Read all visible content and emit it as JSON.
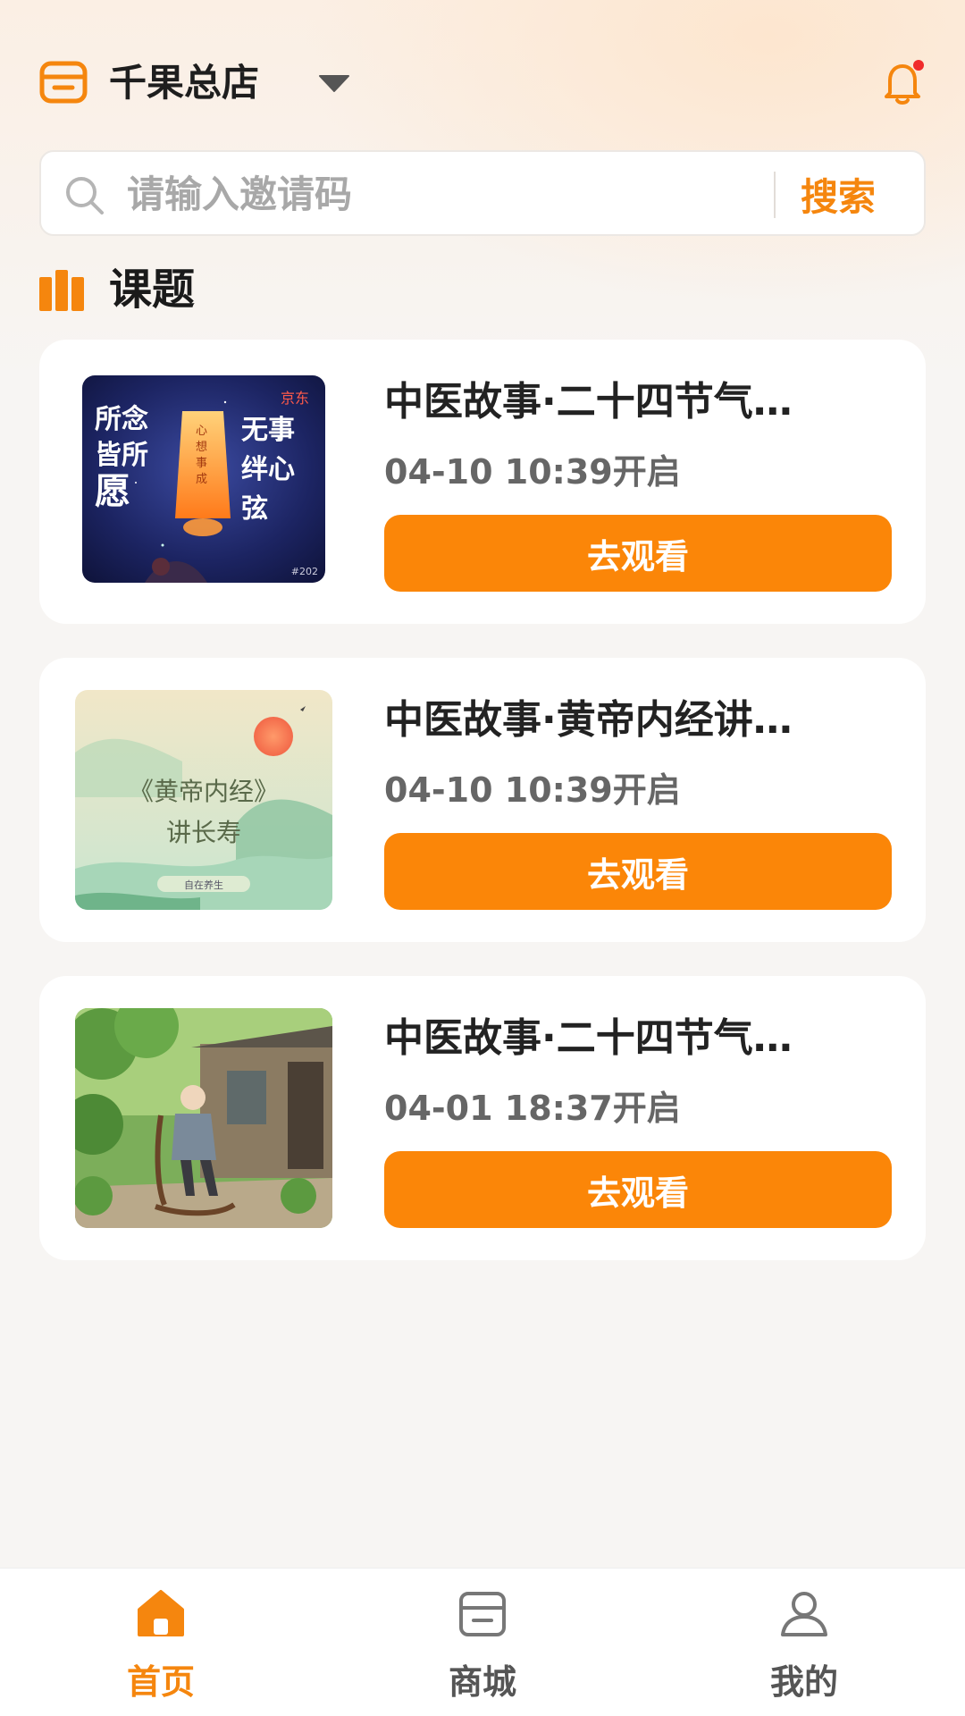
{
  "header": {
    "store_name": "千果总店",
    "store_icon": "storefront-icon",
    "dropdown_icon": "caret-down-icon",
    "bell_icon": "bell-icon",
    "notification_dot": true
  },
  "search": {
    "placeholder": "请输入邀请码",
    "value": "",
    "button_label": "搜索"
  },
  "section": {
    "title": "课题",
    "icon": "books-icon"
  },
  "courses": [
    {
      "title": "中医故事·二十四节气…",
      "time": "04-10 10:39开启",
      "button_label": "去观看",
      "thumb": "lantern-poster"
    },
    {
      "title": "中医故事·黄帝内经讲…",
      "time": "04-10 10:39开启",
      "button_label": "去观看",
      "thumb": "huangdi-neijing-poster"
    },
    {
      "title": "中医故事·二十四节气…",
      "time": "04-01 18:37开启",
      "button_label": "去观看",
      "thumb": "elder-rocking-chair-illustration"
    }
  ],
  "thumb_text": {
    "lantern": {
      "brand": "京东",
      "left_lines": [
        "所念",
        "皆所",
        "愿"
      ],
      "right_lines": [
        "无事",
        "绊心",
        "弦"
      ],
      "lantern_text": "心想事成",
      "corner": "#202"
    },
    "neijing": {
      "title": "《黄帝内经》",
      "subtitle": "讲长寿",
      "footer": "自在养生"
    }
  },
  "tabs": [
    {
      "label": "首页",
      "icon": "home-icon",
      "active": true
    },
    {
      "label": "商城",
      "icon": "shop-icon",
      "active": false
    },
    {
      "label": "我的",
      "icon": "user-icon",
      "active": false
    }
  ],
  "colors": {
    "accent": "#fb8608",
    "accent_text": "#f5860e",
    "background": "#f7f5f3",
    "card": "#ffffff"
  }
}
